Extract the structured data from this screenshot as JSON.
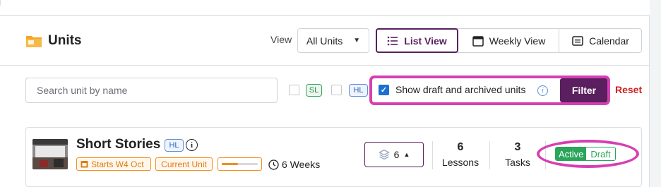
{
  "header": {
    "title": "Units",
    "view_label": "View",
    "units_select": "All Units",
    "tabs": [
      {
        "label": "List View"
      },
      {
        "label": "Weekly View"
      },
      {
        "label": "Calendar"
      }
    ]
  },
  "filters": {
    "search_placeholder": "Search unit by name",
    "sl_label": "SL",
    "hl_label": "HL",
    "show_drafts_label": "Show draft and archived units",
    "filter_button": "Filter",
    "reset_link": "Reset"
  },
  "unit": {
    "name": "Short Stories",
    "level": "HL",
    "starts": "Starts W4 Oct",
    "current": "Current Unit",
    "progress": 0.45,
    "duration": "6 Weeks",
    "layers_count": "6",
    "lessons_count": "6",
    "lessons_label": "Lessons",
    "tasks_count": "3",
    "tasks_label": "Tasks",
    "status_active": "Active",
    "status_draft": "Draft"
  },
  "colors": {
    "accent": "#5a1f5e",
    "highlight": "#d63fb2",
    "status_green": "#2aa55a",
    "orange": "#f28c1d"
  }
}
